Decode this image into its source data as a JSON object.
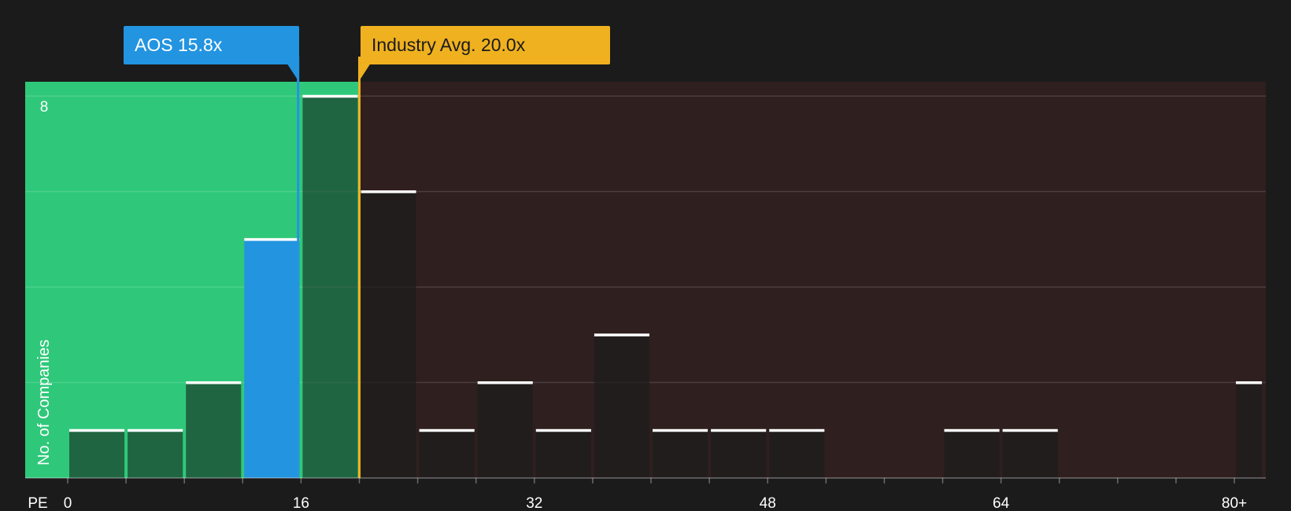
{
  "callouts": {
    "company": {
      "ticker": "AOS",
      "value_label": "15.8x"
    },
    "industry": {
      "label": "Industry Avg.",
      "value_label": "20.0x"
    }
  },
  "colors": {
    "background": "#1b1b1b",
    "undervalued_zone": "#2fc87a",
    "overvalued_zone": "#2f1f1f",
    "company_bar": "#2394e0",
    "industry_marker": "#efb11f",
    "bar_cap": "#ffffff"
  },
  "chart_data": {
    "type": "bar",
    "x_axis_title": "PE",
    "ylabel": "No. of Companies",
    "y_tick_labels": [
      {
        "value": 8,
        "label": "8"
      }
    ],
    "ylim": [
      0,
      8.3
    ],
    "xlim": [
      0,
      82
    ],
    "x_tick_labels": [
      {
        "value": 0,
        "label": "0"
      },
      {
        "value": 16,
        "label": "16"
      },
      {
        "value": 32,
        "label": "32"
      },
      {
        "value": 48,
        "label": "48"
      },
      {
        "value": 64,
        "label": "64"
      },
      {
        "value": 80,
        "label": "80+"
      }
    ],
    "x_minor_ticks": [
      0,
      4,
      8,
      12,
      16,
      20,
      24,
      28,
      32,
      36,
      40,
      44,
      48,
      52,
      56,
      60,
      64,
      68,
      72,
      76,
      80
    ],
    "gridlines": [
      2,
      4,
      6,
      8
    ],
    "company_value": 15.8,
    "industry_avg": 20.0,
    "bins": [
      {
        "x0": 0,
        "x1": 4,
        "count": 1
      },
      {
        "x0": 4,
        "x1": 8,
        "count": 1
      },
      {
        "x0": 8,
        "x1": 12,
        "count": 2
      },
      {
        "x0": 12,
        "x1": 16,
        "count": 5,
        "highlight": "company"
      },
      {
        "x0": 16,
        "x1": 20,
        "count": 8
      },
      {
        "x0": 20,
        "x1": 24,
        "count": 6
      },
      {
        "x0": 24,
        "x1": 28,
        "count": 1
      },
      {
        "x0": 28,
        "x1": 32,
        "count": 2
      },
      {
        "x0": 32,
        "x1": 36,
        "count": 1
      },
      {
        "x0": 36,
        "x1": 40,
        "count": 3
      },
      {
        "x0": 40,
        "x1": 44,
        "count": 1
      },
      {
        "x0": 44,
        "x1": 48,
        "count": 1
      },
      {
        "x0": 48,
        "x1": 52,
        "count": 1
      },
      {
        "x0": 52,
        "x1": 56,
        "count": 0
      },
      {
        "x0": 56,
        "x1": 60,
        "count": 0
      },
      {
        "x0": 60,
        "x1": 64,
        "count": 1
      },
      {
        "x0": 64,
        "x1": 68,
        "count": 1
      },
      {
        "x0": 68,
        "x1": 72,
        "count": 0
      },
      {
        "x0": 72,
        "x1": 76,
        "count": 0
      },
      {
        "x0": 76,
        "x1": 80,
        "count": 0
      },
      {
        "x0": 80,
        "x1": 82,
        "count": 2
      }
    ]
  }
}
